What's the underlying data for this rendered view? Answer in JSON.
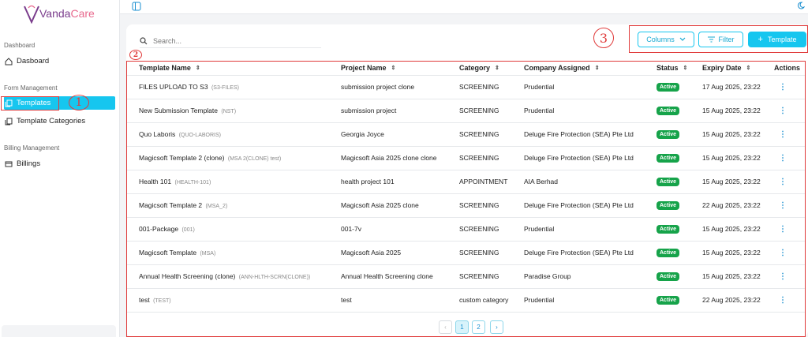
{
  "app": {
    "logo_left": "Vanda",
    "logo_right": "Care"
  },
  "sidebar": {
    "sections": [
      {
        "title": "Dashboard"
      },
      {
        "title": "Form Management"
      },
      {
        "title": "Billing Management"
      }
    ],
    "items": [
      {
        "label": "Dasboard",
        "icon": "home-icon"
      },
      {
        "label": "Templates",
        "icon": "copy-icon",
        "active": true
      },
      {
        "label": "Template Categories",
        "icon": "copy-icon"
      },
      {
        "label": "Billings",
        "icon": "card-icon"
      }
    ]
  },
  "annotations": {
    "one": "1",
    "two": "2",
    "three": "3"
  },
  "toolbar": {
    "search_placeholder": "Search...",
    "columns_label": "Columns",
    "filter_label": "Filter",
    "add_label": "Template"
  },
  "table": {
    "columns": [
      "Template Name",
      "Project Name",
      "Category",
      "Company Assigned",
      "Status",
      "Expiry Date",
      "Actions"
    ],
    "rows": [
      {
        "name": "FILES UPLOAD TO S3",
        "code": "(S3-FILES)",
        "project": "submission project clone",
        "category": "SCREENING",
        "company": "Prudential",
        "status": "Active",
        "expiry": "17 Aug 2025, 23:22"
      },
      {
        "name": "New Submission Template",
        "code": "(NST)",
        "project": "submission project",
        "category": "SCREENING",
        "company": "Prudential",
        "status": "Active",
        "expiry": "15 Aug 2025, 23:22"
      },
      {
        "name": "Quo Laboris",
        "code": "(QUO-LABORIS)",
        "project": "Georgia Joyce",
        "category": "SCREENING",
        "company": "Deluge Fire Protection (SEA) Pte Ltd",
        "status": "Active",
        "expiry": "15 Aug 2025, 23:22"
      },
      {
        "name": "Magicsoft Template 2 (clone)",
        "code": "(MSA 2(CLONE) test)",
        "project": "Magicsoft Asia 2025 clone clone",
        "category": "SCREENING",
        "company": "Deluge Fire Protection (SEA) Pte Ltd",
        "status": "Active",
        "expiry": "15 Aug 2025, 23:22"
      },
      {
        "name": "Health 101",
        "code": "(HEALTH-101)",
        "project": "health project 101",
        "category": "APPOINTMENT",
        "company": "AIA Berhad",
        "status": "Active",
        "expiry": "15 Aug 2025, 23:22"
      },
      {
        "name": "Magicsoft Template 2",
        "code": "(MSA_2)",
        "project": "Magicsoft Asia 2025 clone",
        "category": "SCREENING",
        "company": "Deluge Fire Protection (SEA) Pte Ltd",
        "status": "Active",
        "expiry": "22 Aug 2025, 23:22"
      },
      {
        "name": "001-Package",
        "code": "(001)",
        "project": "001-7v",
        "category": "SCREENING",
        "company": "Prudential",
        "status": "Active",
        "expiry": "15 Aug 2025, 23:22"
      },
      {
        "name": "Magicsoft Template",
        "code": "(MSA)",
        "project": "Magicsoft Asia 2025",
        "category": "SCREENING",
        "company": "Deluge Fire Protection (SEA) Pte Ltd",
        "status": "Active",
        "expiry": "15 Aug 2025, 23:22"
      },
      {
        "name": "Annual Health Screening (clone)",
        "code": "(ANN-HLTH-SCRN(CLONE))",
        "project": "Annual Health Screening clone",
        "category": "SCREENING",
        "company": "Paradise Group",
        "status": "Active",
        "expiry": "15 Aug 2025, 23:22"
      },
      {
        "name": "test",
        "code": "(TEST)",
        "project": "test",
        "category": "custom category",
        "company": "Prudential",
        "status": "Active",
        "expiry": "22 Aug 2025, 23:22"
      }
    ]
  },
  "pagination": {
    "prev": "‹",
    "pages": [
      "1",
      "2"
    ],
    "current": "1",
    "next": "›"
  },
  "colors": {
    "accent": "#16c6ef",
    "active_badge": "#16a34a",
    "annotation": "#e03b3b"
  }
}
